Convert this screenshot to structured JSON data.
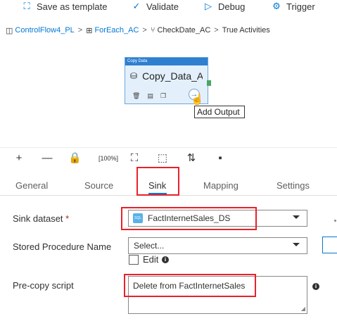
{
  "toolbar": {
    "save_template": "Save as template",
    "validate": "Validate",
    "debug": "Debug",
    "trigger": "Trigger"
  },
  "breadcrumb": {
    "pipeline": "ControlFlow4_PL",
    "foreach": "ForEach_AC",
    "ifcondition": "CheckDate_AC",
    "current": "True Activities",
    "separator": ">"
  },
  "canvas": {
    "activity": {
      "type_label": "Copy Data",
      "name": "Copy_Data_AC"
    },
    "tooltip": "Add Output"
  },
  "tabs": [
    {
      "label": "General"
    },
    {
      "label": "Source"
    },
    {
      "label": "Sink"
    },
    {
      "label": "Mapping"
    },
    {
      "label": "Settings"
    }
  ],
  "form": {
    "sink_dataset_label": "Sink dataset",
    "required_marker": "*",
    "sink_dataset_value": "FactInternetSales_DS",
    "sink_dataset_icon_text": "SQL",
    "stored_proc_label": "Stored Procedure Name",
    "stored_proc_value": "Select...",
    "edit_label": "Edit",
    "precopy_label": "Pre-copy script",
    "precopy_value": "Delete from FactInternetSales"
  },
  "colors": {
    "accent": "#0078d4",
    "highlight": "#e8212a",
    "activity_header": "#2f7fd1"
  }
}
